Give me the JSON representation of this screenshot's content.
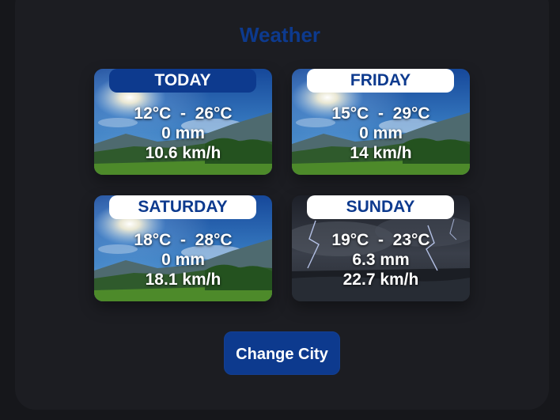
{
  "header": {
    "title": "Weather"
  },
  "forecast": [
    {
      "day": "TODAY",
      "temp": "12°C  -  26°C",
      "rain": "0 mm",
      "wind": "10.6 km/h",
      "condition": "sunny",
      "label_style": "dark"
    },
    {
      "day": "FRIDAY",
      "temp": "15°C  -  29°C",
      "rain": "0 mm",
      "wind": "14 km/h",
      "condition": "sunny",
      "label_style": "light"
    },
    {
      "day": "SATURDAY",
      "temp": "18°C  -  28°C",
      "rain": "0 mm",
      "wind": "18.1 km/h",
      "condition": "sunny",
      "label_style": "light"
    },
    {
      "day": "SUNDAY",
      "temp": "19°C  -  23°C",
      "rain": "6.3 mm",
      "wind": "22.7 km/h",
      "condition": "storm",
      "label_style": "light"
    }
  ],
  "actions": {
    "change_city_label": "Change City"
  },
  "colors": {
    "accent": "#0d3a8e",
    "page_background": "#16171b",
    "panel_background": "#1c1d22",
    "text_light": "#ffffff"
  },
  "icons": {
    "sunny": "sunny-landscape-icon",
    "storm": "thunderstorm-icon"
  }
}
